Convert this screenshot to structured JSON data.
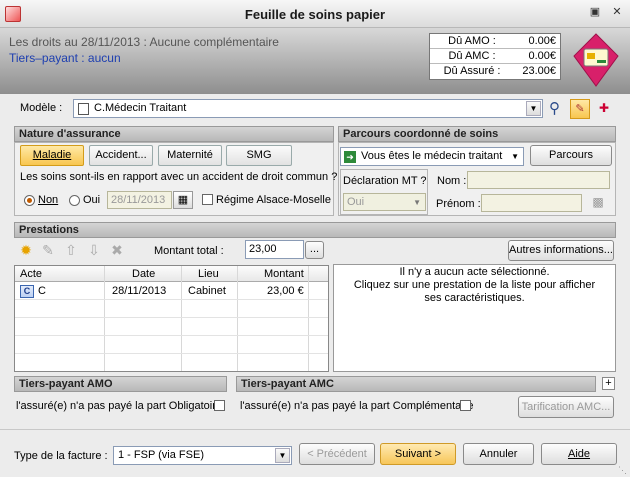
{
  "window": {
    "title": "Feuille de soins papier"
  },
  "header": {
    "line1": "Les droits au 28/11/2013 : Aucune complémentaire",
    "line2": "Tiers–payant : aucun",
    "dues": [
      {
        "label": "Dû AMO :",
        "value": "0.00€"
      },
      {
        "label": "Dû AMC :",
        "value": "0.00€"
      },
      {
        "label": "Dû Assuré :",
        "value": "23.00€"
      }
    ]
  },
  "model": {
    "label": "Modèle :",
    "value": "C.Médecin Traitant"
  },
  "nature": {
    "heading": "Nature d'assurance",
    "tabs": [
      "Maladie",
      "Accident...",
      "Maternité",
      "SMG"
    ],
    "question": "Les soins sont-ils en rapport avec un accident de droit commun ?",
    "opt_no": "Non",
    "opt_yes": "Oui",
    "date": "28/11/2013",
    "alsace": "Régime Alsace-Moselle"
  },
  "parcours": {
    "heading": "Parcours coordonné de soins",
    "select_value": "Vous êtes le médecin traitant",
    "button": "Parcours",
    "decl_label": "Déclaration MT ?",
    "decl_value": "Oui",
    "nom_label": "Nom :",
    "prenom_label": "Prénom :"
  },
  "prestations": {
    "heading": "Prestations",
    "total_label": "Montant total :",
    "total_value": "23,00",
    "total_btn": "...",
    "more_btn": "Autres informations...",
    "columns": [
      "Acte",
      "Date",
      "Lieu",
      "Montant"
    ],
    "rows": [
      {
        "acte": "C",
        "date": "28/11/2013",
        "lieu": "Cabinet",
        "montant": "23,00 €"
      }
    ],
    "info_text_1": "Il n'y a aucun acte sélectionné.",
    "info_text_2": "Cliquez sur une prestation de la liste pour afficher ses caractéristiques."
  },
  "tp_amo": {
    "heading": "Tiers-payant AMO",
    "label": "l'assuré(e) n'a pas payé la part Obligatoire"
  },
  "tp_amc": {
    "heading": "Tiers-payant AMC",
    "label": "l'assuré(e) n'a pas payé la part Complémentaire",
    "button": "Tarification AMC..."
  },
  "footer": {
    "type_label": "Type de la facture :",
    "type_value": "1 - FSP (via FSE)",
    "prev": "< Précédent",
    "next": "Suivant >",
    "cancel": "Annuler",
    "help": "Aide"
  }
}
